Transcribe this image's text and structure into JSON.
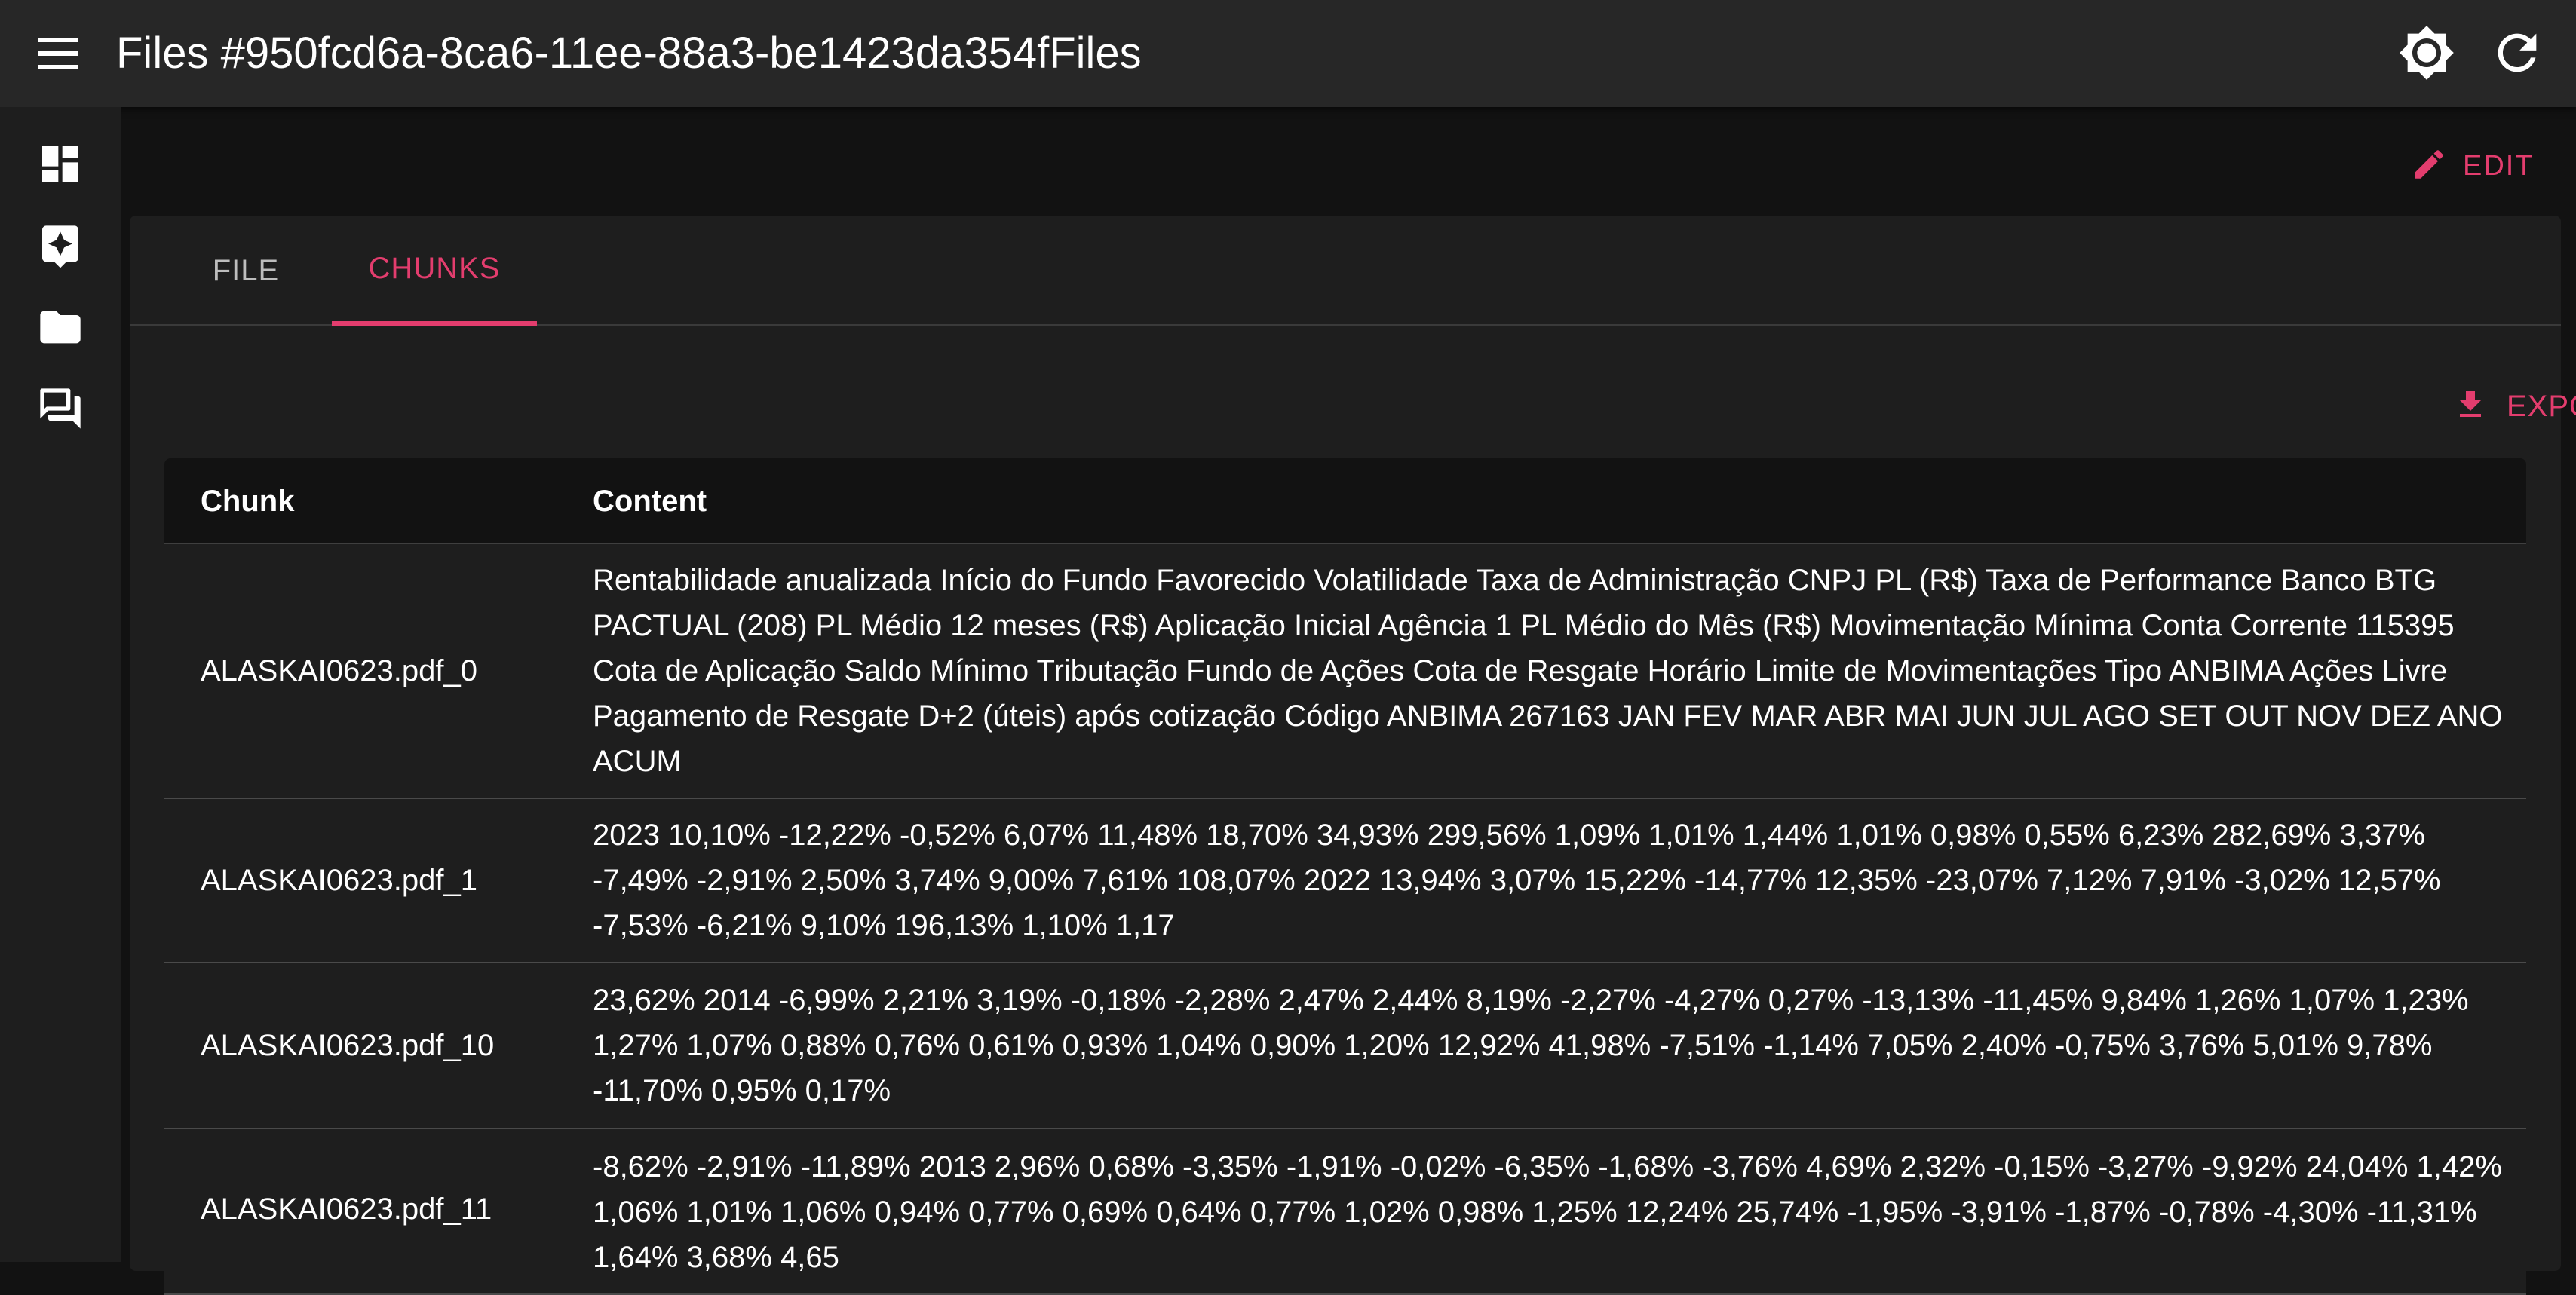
{
  "appbar": {
    "title": "Files #950fcd6a-8ca6-11ee-88a3-be1423da354fFiles",
    "menu_icon": "hamburger-menu-icon",
    "theme_icon": "brightness-icon",
    "refresh_icon": "refresh-icon"
  },
  "sidebar": {
    "items": [
      {
        "icon": "dashboard-icon"
      },
      {
        "icon": "assistant-icon"
      },
      {
        "icon": "folder-icon"
      },
      {
        "icon": "forum-icon"
      }
    ]
  },
  "actions": {
    "edit_label": "EDIT",
    "export_label": "EXPORT"
  },
  "tabs": [
    {
      "label": "FILE",
      "active": false
    },
    {
      "label": "CHUNKS",
      "active": true
    }
  ],
  "table": {
    "headers": {
      "chunk": "Chunk",
      "content": "Content"
    },
    "rows": [
      {
        "chunk": "ALASKAI0623.pdf_0",
        "content": "Rentabilidade anualizada Início do Fundo Favorecido Volatilidade Taxa de Administração CNPJ PL (R$) Taxa de Performance Banco BTG PACTUAL (208) PL Médio 12 meses (R$) Aplicação Inicial Agência 1 PL Médio do Mês (R$) Movimentação Mínima Conta Corrente 115395 Cota de Aplicação Saldo Mínimo Tributação Fundo de Ações Cota de Resgate Horário Limite de Movimentações Tipo ANBIMA Ações Livre Pagamento de Resgate D+2 (úteis) após cotização Código ANBIMA 267163 JAN FEV MAR ABR MAI JUN JUL AGO SET OUT NOV DEZ ANO ACUM"
      },
      {
        "chunk": "ALASKAI0623.pdf_1",
        "content": "2023 10,10% -12,22% -0,52% 6,07% 11,48% 18,70% 34,93% 299,56% 1,09% 1,01% 1,44% 1,01% 0,98% 0,55% 6,23% 282,69% 3,37% -7,49% -2,91% 2,50% 3,74% 9,00% 7,61% 108,07% 2022 13,94% 3,07% 15,22% -14,77% 12,35% -23,07% 7,12% 7,91% -3,02% 12,57% -7,53% -6,21% 9,10% 196,13% 1,10% 1,17"
      },
      {
        "chunk": "ALASKAI0623.pdf_10",
        "content": "23,62% 2014 -6,99% 2,21% 3,19% -0,18% -2,28% 2,47% 2,44% 8,19% -2,27% -4,27% 0,27% -13,13% -11,45% 9,84% 1,26% 1,07% 1,23% 1,27% 1,07% 0,88% 0,76% 0,61% 0,93% 1,04% 0,90% 1,20% 12,92% 41,98% -7,51% -1,14% 7,05% 2,40% -0,75% 3,76% 5,01% 9,78% -11,70% 0,95% 0,17%"
      },
      {
        "chunk": "ALASKAI0623.pdf_11",
        "content": "-8,62% -2,91% -11,89% 2013 2,96% 0,68% -3,35% -1,91% -0,02% -6,35% -1,68% -3,76% 4,69% 2,32% -0,15% -3,27% -9,92% 24,04% 1,42% 1,06% 1,01% 1,06% 0,94% 0,77% 0,69% 0,64% 0,77% 1,02% 0,98% 1,25% 12,24% 25,74% -1,95% -3,91% -1,87% -0,78% -4,30% -11,31% 1,64% 3,68% 4,65"
      }
    ]
  },
  "colors": {
    "accent": "#e33d6e",
    "appbar_bg": "#272727",
    "page_bg": "#121212",
    "card_bg": "#1e1e1e"
  }
}
